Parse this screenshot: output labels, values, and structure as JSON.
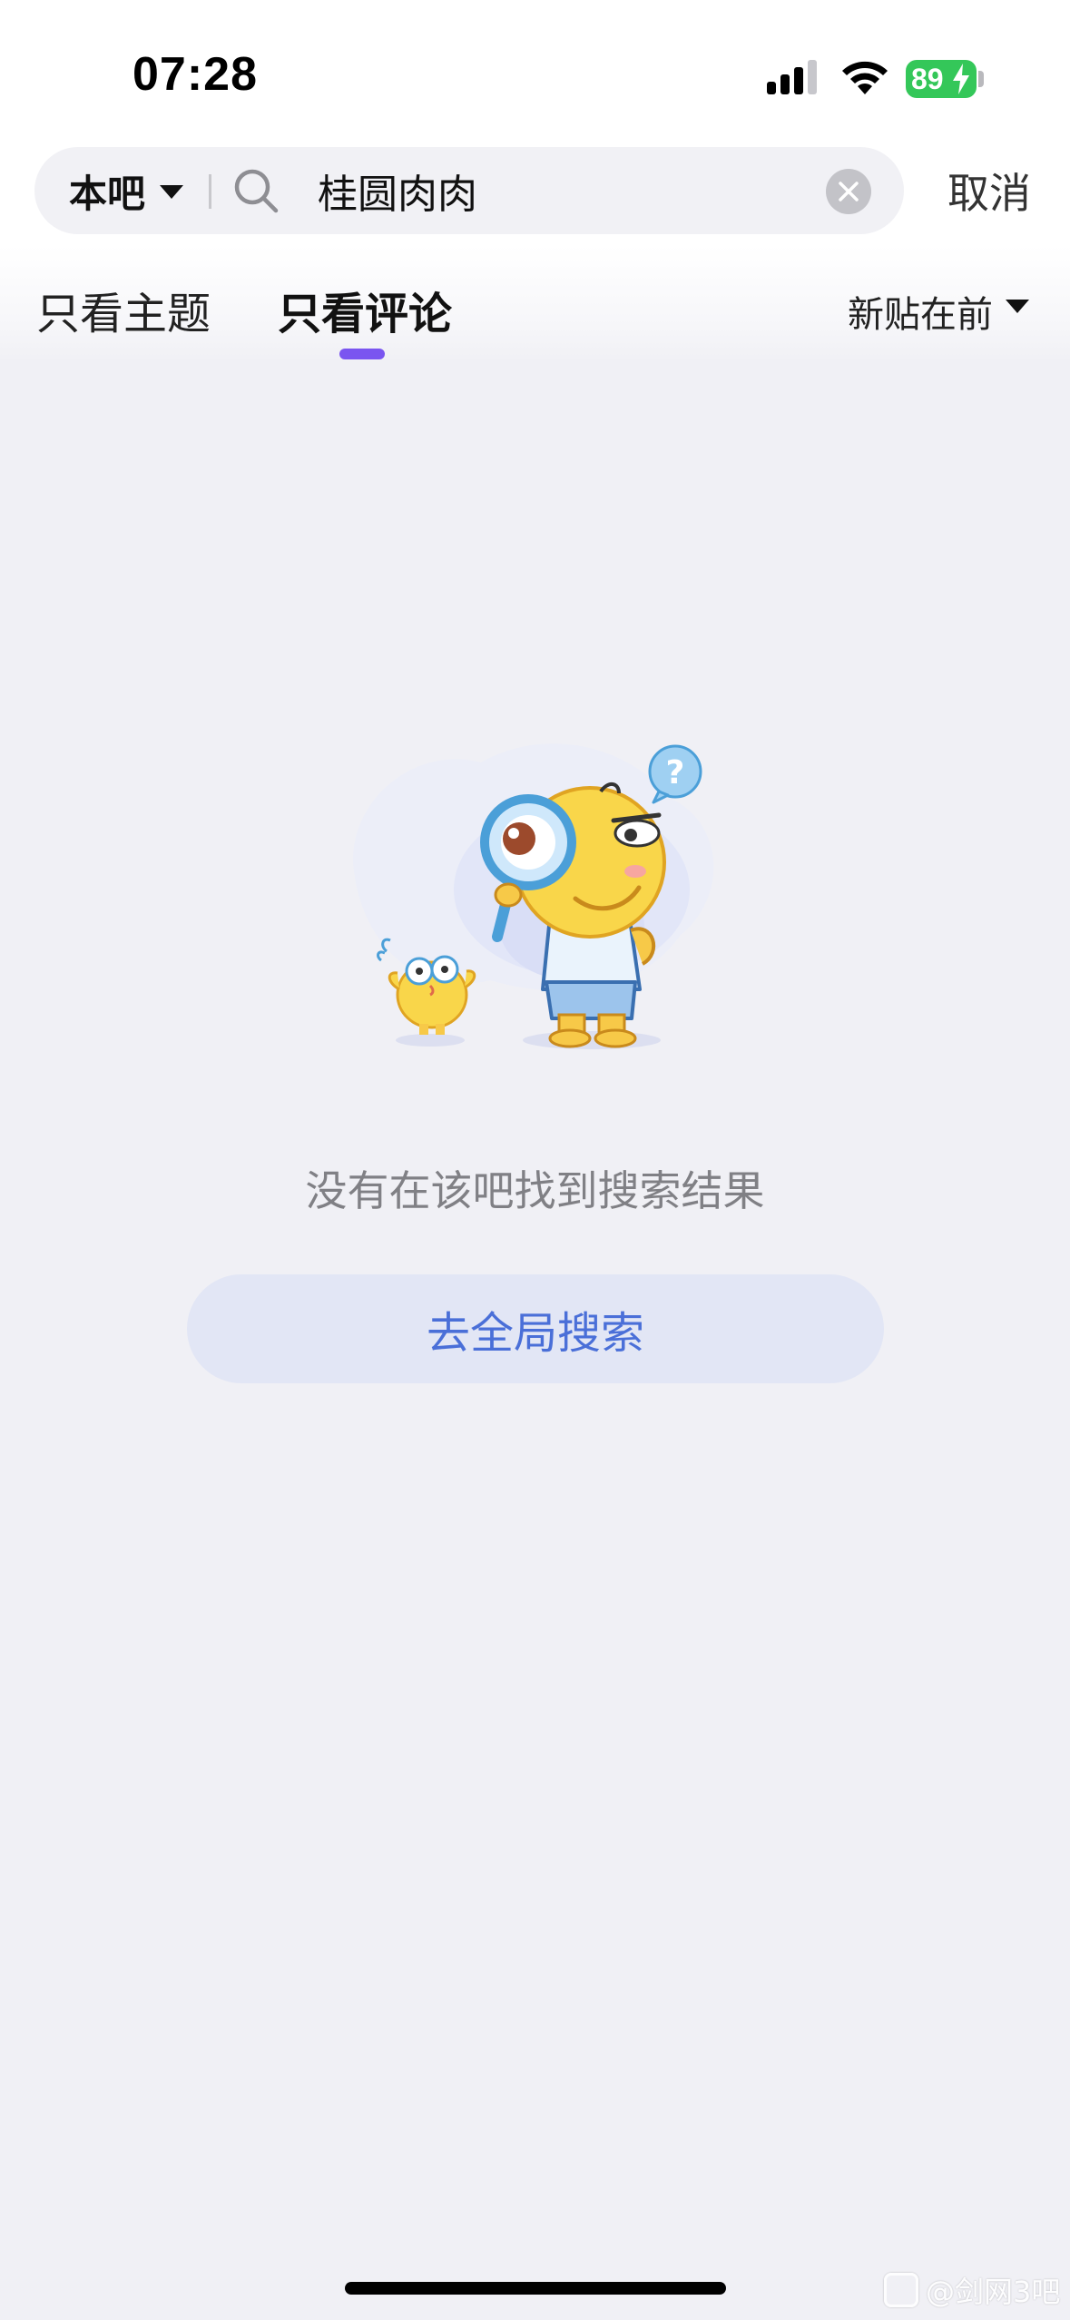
{
  "status_bar": {
    "time": "07:28",
    "battery": "89"
  },
  "search": {
    "scope_label": "本吧",
    "query": "桂圆肉肉",
    "cancel_label": "取消"
  },
  "tabs": [
    {
      "label": "只看主题",
      "active": false
    },
    {
      "label": "只看评论",
      "active": true
    }
  ],
  "sort": {
    "label": "新贴在前"
  },
  "empty_state": {
    "message": "没有在该吧找到搜索结果",
    "button_label": "去全局搜索"
  },
  "watermark": {
    "text": "@剑网3吧"
  },
  "colors": {
    "accent": "#7a55f0",
    "button_bg": "#e2e6f5",
    "button_text": "#4a6fd8",
    "battery": "#34c759",
    "page_bg": "#f0f0f5"
  },
  "icons": [
    "signal-icon",
    "wifi-icon",
    "battery-icon",
    "caret-down-icon",
    "search-icon",
    "clear-icon",
    "mascot-illustration",
    "question-bubble-icon"
  ]
}
